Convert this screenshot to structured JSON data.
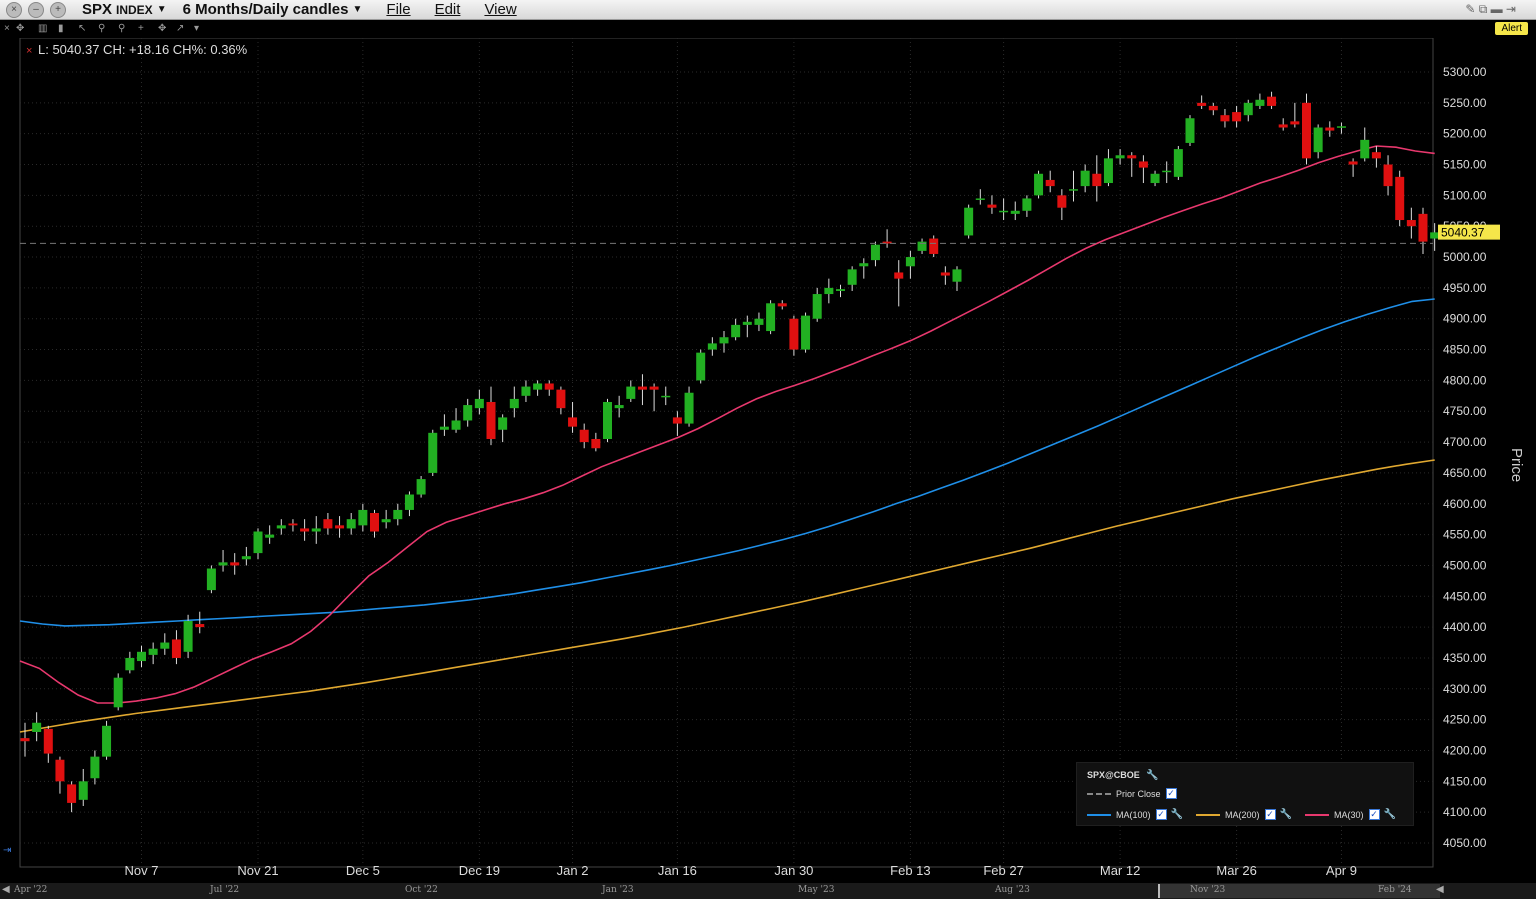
{
  "window": {
    "symbol": "SPX",
    "symbol_type": "INDEX",
    "timeframe": "6 Months/Daily candles",
    "menus": [
      "File",
      "Edit",
      "View"
    ]
  },
  "toolbar": {
    "alert_label": "Alert"
  },
  "info_line": "L: 5040.37 CH: +18.16 CH%: 0.36%",
  "chart_data": {
    "type": "candlestick",
    "ylabel": "Price",
    "ylim": [
      4050,
      5300
    ],
    "y_ticks": [
      "5300.00",
      "5250.00",
      "5200.00",
      "5150.00",
      "5100.00",
      "5050.00",
      "5000.00",
      "4950.00",
      "4900.00",
      "4850.00",
      "4800.00",
      "4750.00",
      "4700.00",
      "4650.00",
      "4600.00",
      "4550.00",
      "4500.00",
      "4450.00",
      "4400.00",
      "4350.00",
      "4300.00",
      "4250.00",
      "4200.00",
      "4150.00",
      "4100.00",
      "4050.00"
    ],
    "x_ticks": [
      {
        "label": "Nov 7",
        "index": 10
      },
      {
        "label": "Nov 21",
        "index": 20
      },
      {
        "label": "Dec 5",
        "index": 29
      },
      {
        "label": "Dec 19",
        "index": 39
      },
      {
        "label": "Jan 2",
        "index": 47
      },
      {
        "label": "Jan 16",
        "index": 56
      },
      {
        "label": "Jan 30",
        "index": 66
      },
      {
        "label": "Feb 13",
        "index": 76
      },
      {
        "label": "Feb 27",
        "index": 84
      },
      {
        "label": "Mar 12",
        "index": 94
      },
      {
        "label": "Mar 26",
        "index": 104
      },
      {
        "label": "Apr 9",
        "index": 113
      }
    ],
    "last_price_label": "5040.37",
    "prior_close": 5022.21,
    "candles": [
      [
        4220,
        4245,
        4190,
        4215
      ],
      [
        4230,
        4262,
        4215,
        4245
      ],
      [
        4235,
        4240,
        4180,
        4195
      ],
      [
        4185,
        4190,
        4130,
        4150
      ],
      [
        4145,
        4150,
        4100,
        4115
      ],
      [
        4120,
        4170,
        4110,
        4150
      ],
      [
        4155,
        4200,
        4145,
        4190
      ],
      [
        4190,
        4248,
        4185,
        4240
      ],
      [
        4270,
        4325,
        4265,
        4318
      ],
      [
        4330,
        4360,
        4325,
        4350
      ],
      [
        4345,
        4370,
        4335,
        4360
      ],
      [
        4355,
        4375,
        4340,
        4365
      ],
      [
        4365,
        4390,
        4355,
        4375
      ],
      [
        4380,
        4395,
        4340,
        4350
      ],
      [
        4360,
        4420,
        4350,
        4410
      ],
      [
        4405,
        4425,
        4390,
        4400
      ],
      [
        4460,
        4500,
        4455,
        4495
      ],
      [
        4500,
        4525,
        4490,
        4505
      ],
      [
        4505,
        4520,
        4485,
        4500
      ],
      [
        4510,
        4530,
        4500,
        4515
      ],
      [
        4520,
        4560,
        4510,
        4555
      ],
      [
        4545,
        4565,
        4535,
        4550
      ],
      [
        4560,
        4575,
        4550,
        4565
      ],
      [
        4568,
        4575,
        4555,
        4565
      ],
      [
        4560,
        4575,
        4540,
        4555
      ],
      [
        4555,
        4580,
        4535,
        4560
      ],
      [
        4575,
        4585,
        4550,
        4560
      ],
      [
        4565,
        4580,
        4545,
        4560
      ],
      [
        4560,
        4585,
        4550,
        4575
      ],
      [
        4565,
        4600,
        4555,
        4590
      ],
      [
        4585,
        4590,
        4545,
        4555
      ],
      [
        4570,
        4590,
        4560,
        4575
      ],
      [
        4575,
        4600,
        4565,
        4590
      ],
      [
        4590,
        4620,
        4580,
        4615
      ],
      [
        4615,
        4645,
        4610,
        4640
      ],
      [
        4650,
        4720,
        4645,
        4715
      ],
      [
        4720,
        4745,
        4710,
        4725
      ],
      [
        4720,
        4755,
        4715,
        4735
      ],
      [
        4735,
        4770,
        4725,
        4760
      ],
      [
        4755,
        4785,
        4745,
        4770
      ],
      [
        4765,
        4790,
        4695,
        4705
      ],
      [
        4720,
        4745,
        4700,
        4740
      ],
      [
        4755,
        4790,
        4740,
        4770
      ],
      [
        4775,
        4800,
        4765,
        4790
      ],
      [
        4785,
        4800,
        4775,
        4795
      ],
      [
        4795,
        4800,
        4775,
        4785
      ],
      [
        4785,
        4790,
        4745,
        4755
      ],
      [
        4740,
        4765,
        4715,
        4725
      ],
      [
        4720,
        4730,
        4690,
        4700
      ],
      [
        4705,
        4715,
        4685,
        4690
      ],
      [
        4705,
        4770,
        4700,
        4765
      ],
      [
        4755,
        4775,
        4740,
        4760
      ],
      [
        4770,
        4800,
        4765,
        4790
      ],
      [
        4790,
        4810,
        4760,
        4785
      ],
      [
        4790,
        4795,
        4750,
        4785
      ],
      [
        4775,
        4790,
        4760,
        4775
      ],
      [
        4740,
        4750,
        4710,
        4730
      ],
      [
        4730,
        4790,
        4725,
        4780
      ],
      [
        4800,
        4850,
        4795,
        4845
      ],
      [
        4850,
        4870,
        4840,
        4860
      ],
      [
        4860,
        4880,
        4845,
        4870
      ],
      [
        4870,
        4900,
        4865,
        4890
      ],
      [
        4890,
        4905,
        4870,
        4895
      ],
      [
        4890,
        4910,
        4880,
        4900
      ],
      [
        4880,
        4930,
        4875,
        4925
      ],
      [
        4925,
        4930,
        4915,
        4920
      ],
      [
        4900,
        4905,
        4840,
        4850
      ],
      [
        4850,
        4910,
        4845,
        4905
      ],
      [
        4900,
        4950,
        4895,
        4940
      ],
      [
        4940,
        4965,
        4925,
        4950
      ],
      [
        4945,
        4955,
        4935,
        4948
      ],
      [
        4955,
        4985,
        4945,
        4980
      ],
      [
        4985,
        4998,
        4965,
        4990
      ],
      [
        4995,
        5025,
        4985,
        5020
      ],
      [
        5025,
        5045,
        5015,
        5022
      ],
      [
        4975,
        4995,
        4920,
        4965
      ],
      [
        4985,
        5010,
        4965,
        5000
      ],
      [
        5010,
        5030,
        5005,
        5025
      ],
      [
        5030,
        5035,
        5000,
        5005
      ],
      [
        4975,
        4985,
        4955,
        4970
      ],
      [
        4960,
        4985,
        4945,
        4980
      ],
      [
        5035,
        5085,
        5030,
        5080
      ],
      [
        5095,
        5110,
        5085,
        5095
      ],
      [
        5085,
        5100,
        5070,
        5080
      ],
      [
        5075,
        5095,
        5060,
        5075
      ],
      [
        5070,
        5090,
        5060,
        5075
      ],
      [
        5075,
        5100,
        5065,
        5095
      ],
      [
        5100,
        5140,
        5095,
        5135
      ],
      [
        5125,
        5140,
        5105,
        5115
      ],
      [
        5100,
        5110,
        5060,
        5080
      ],
      [
        5110,
        5140,
        5090,
        5110
      ],
      [
        5115,
        5150,
        5105,
        5140
      ],
      [
        5135,
        5165,
        5090,
        5115
      ],
      [
        5120,
        5175,
        5115,
        5160
      ],
      [
        5160,
        5175,
        5150,
        5165
      ],
      [
        5165,
        5170,
        5130,
        5160
      ],
      [
        5155,
        5165,
        5120,
        5145
      ],
      [
        5120,
        5140,
        5115,
        5135
      ],
      [
        5140,
        5155,
        5120,
        5140
      ],
      [
        5130,
        5180,
        5125,
        5175
      ],
      [
        5185,
        5230,
        5180,
        5225
      ],
      [
        5250,
        5262,
        5240,
        5245
      ],
      [
        5245,
        5250,
        5230,
        5238
      ],
      [
        5230,
        5240,
        5210,
        5220
      ],
      [
        5235,
        5245,
        5210,
        5220
      ],
      [
        5230,
        5255,
        5220,
        5250
      ],
      [
        5245,
        5265,
        5240,
        5255
      ],
      [
        5260,
        5268,
        5240,
        5245
      ],
      [
        5215,
        5225,
        5205,
        5210
      ],
      [
        5220,
        5250,
        5210,
        5215
      ],
      [
        5250,
        5265,
        5150,
        5160
      ],
      [
        5170,
        5215,
        5160,
        5210
      ],
      [
        5210,
        5220,
        5195,
        5205
      ],
      [
        5210,
        5218,
        5200,
        5212
      ],
      [
        5155,
        5160,
        5130,
        5150
      ],
      [
        5160,
        5210,
        5155,
        5190
      ],
      [
        5170,
        5180,
        5145,
        5160
      ],
      [
        5150,
        5165,
        5100,
        5115
      ],
      [
        5130,
        5140,
        5050,
        5060
      ],
      [
        5060,
        5080,
        5030,
        5050
      ],
      [
        5070,
        5080,
        5005,
        5025
      ],
      [
        5030,
        5055,
        5010,
        5040
      ]
    ],
    "series": [
      {
        "name": "MA(100)",
        "color": "#1f8fe8",
        "values": [
          4410,
          4405,
          4402,
          4403,
          4404,
          4406,
          4408,
          4410,
          4412,
          4414,
          4416,
          4418,
          4420,
          4422,
          4424,
          4427,
          4430,
          4433,
          4436,
          4440,
          4444,
          4449,
          4454,
          4460,
          4466,
          4472,
          4479,
          4486,
          4493,
          4500,
          4508,
          4516,
          4524,
          4533,
          4542,
          4552,
          4563,
          4575,
          4587,
          4600,
          4612,
          4625,
          4638,
          4652,
          4666,
          4681,
          4696,
          4711,
          4726,
          4742,
          4758,
          4774,
          4790,
          4806,
          4822,
          4838,
          4853,
          4868,
          4882,
          4895,
          4907,
          4918,
          4928,
          4932
        ]
      },
      {
        "name": "MA(200)",
        "color": "#e0a830",
        "values": [
          4230,
          4238,
          4246,
          4253,
          4260,
          4266,
          4272,
          4278,
          4284,
          4290,
          4296,
          4303,
          4310,
          4318,
          4326,
          4334,
          4342,
          4350,
          4358,
          4366,
          4374,
          4382,
          4391,
          4400,
          4410,
          4420,
          4430,
          4440,
          4451,
          4462,
          4473,
          4484,
          4495,
          4506,
          4517,
          4528,
          4540,
          4552,
          4564,
          4575,
          4586,
          4597,
          4608,
          4618,
          4628,
          4638,
          4647,
          4656,
          4664,
          4671
        ]
      },
      {
        "name": "MA(30)",
        "color": "#e8386e",
        "values": [
          4345,
          4333,
          4310,
          4290,
          4277,
          4277,
          4280,
          4285,
          4292,
          4303,
          4318,
          4333,
          4348,
          4360,
          4373,
          4393,
          4420,
          4452,
          4483,
          4505,
          4530,
          4555,
          4570,
          4580,
          4590,
          4600,
          4608,
          4618,
          4630,
          4645,
          4660,
          4672,
          4684,
          4696,
          4708,
          4722,
          4738,
          4755,
          4770,
          4782,
          4792,
          4803,
          4815,
          4827,
          4840,
          4852,
          4865,
          4880,
          4896,
          4912,
          4928,
          4945,
          4962,
          4980,
          4998,
          5014,
          5028,
          5040,
          5052,
          5064,
          5075,
          5086,
          5096,
          5108,
          5120,
          5130,
          5141,
          5153,
          5163,
          5172,
          5180,
          5178,
          5172,
          5168
        ]
      }
    ]
  },
  "legend": {
    "title": "SPX@CBOE",
    "prior_close_label": "Prior Close",
    "items": [
      "MA(100)",
      "MA(200)",
      "MA(30)"
    ]
  },
  "scrollbar": {
    "labels": [
      "Apr '22",
      "Jul '22",
      "Oct '22",
      "Jan '23",
      "May '23",
      "Aug '23",
      "Nov '23",
      "Feb '24"
    ]
  },
  "colors": {
    "up": "#22b022",
    "down": "#e01010",
    "grid": "#2a2a2a",
    "last_label_bg": "#f5e64a"
  }
}
